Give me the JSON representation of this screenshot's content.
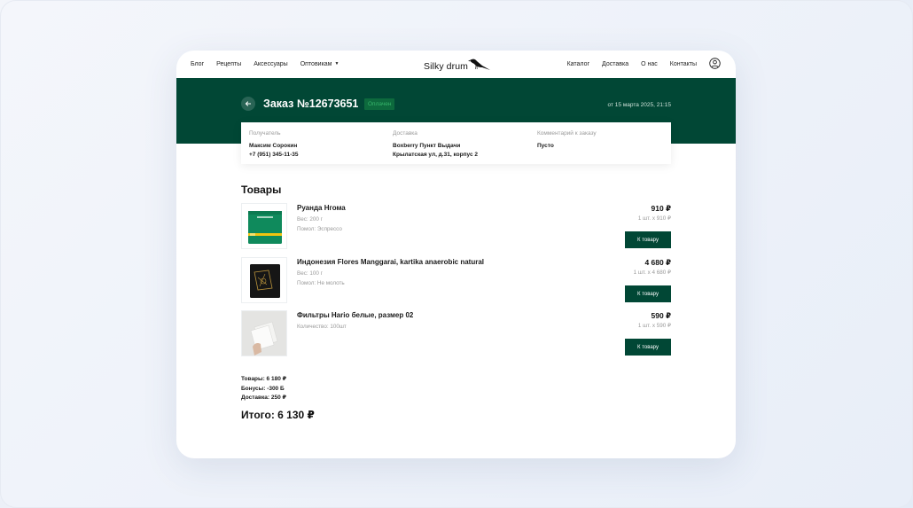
{
  "header": {
    "nav_left": [
      {
        "label": "Блог"
      },
      {
        "label": "Рецепты"
      },
      {
        "label": "Аксессуары"
      },
      {
        "label": "Оптовикам"
      }
    ],
    "nav_right": [
      {
        "label": "Каталог"
      },
      {
        "label": "Доставка"
      },
      {
        "label": "О нас"
      },
      {
        "label": "Контакты"
      }
    ],
    "logo_text": "Silky drum",
    "user_icon": "user-circle-icon"
  },
  "order": {
    "title": "Заказ №12673651",
    "status": "Оплачен",
    "date": "от 15 марта 2025, 21:15"
  },
  "info": {
    "recipient": {
      "label": "Получатель",
      "lines": [
        "Максим Сорокин",
        "+7 (951) 345-11-35"
      ]
    },
    "delivery": {
      "label": "Доставка",
      "lines": [
        "Boxberry Пункт Выдачи",
        "Крылатская ул, д.31, корпус 2"
      ]
    },
    "comment": {
      "label": "Комментарий к заказу",
      "lines": [
        "Пусто"
      ]
    }
  },
  "products_title": "Товары",
  "products": [
    {
      "name": "Руанда Нгома",
      "meta": [
        "Вес: 200 г",
        "Помол: Эспрессо"
      ],
      "price": "910 ₽",
      "qty": "1 шт. x 910 ₽",
      "button": "К товару"
    },
    {
      "name": "Индонезия Flores Manggarai, kartika anaerobic natural",
      "meta": [
        "Вес: 100 г",
        "Помол: Не молоть"
      ],
      "price": "4 680 ₽",
      "qty": "1 шт. x 4 680 ₽",
      "button": "К товару"
    },
    {
      "name": "Фильтры Hario белые, размер 02",
      "meta": [
        "Количество: 100шт"
      ],
      "price": "590 ₽",
      "qty": "1 шт. x 590 ₽",
      "button": "К товару"
    }
  ],
  "summary": {
    "goods": "Товары: 6 180 ₽",
    "bonuses": "Бонусы: -300 Б",
    "delivery": "Доставка: 250 ₽",
    "total": "Итого: 6 130 ₽"
  },
  "colors": {
    "brand_green": "#014735",
    "status_green": "#36b46a"
  }
}
